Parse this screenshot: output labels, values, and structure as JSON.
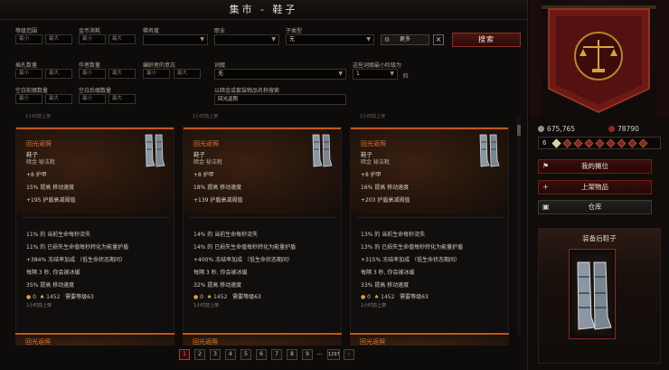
{
  "title": "集市 - 鞋子",
  "filters": {
    "row1": {
      "level_label": "等级范围",
      "level_min": "最小",
      "level_max": "最大",
      "price_label": "金币消耗",
      "price_min": "最小",
      "price_max": "最大",
      "rarity_label": "稀有度",
      "rarity_value": "",
      "class_label": "职业",
      "class_value": "",
      "subtype_label": "子类型",
      "subtype_value": "无",
      "more_label": "更多",
      "clear_label": "×",
      "search_label": "搜索"
    },
    "row2": {
      "sockets_label": "插孔数量",
      "sockets_min": "最小",
      "sockets_max": "最大",
      "dur_label": "作者数量",
      "dur_min": "最小",
      "dur_max": "最大",
      "will_label": "编织者的意志",
      "will_min": "最小",
      "will_max": "最大",
      "affix_label": "词缀",
      "affix_value": "无",
      "min_level_label": "这些词缀最小阶级为",
      "min_level_value": "1",
      "min_level_suffix": "阶"
    },
    "row3": {
      "empty_pre_label": "空白前缀数量",
      "empty_pre_min": "最小",
      "empty_pre_max": "最大",
      "empty_suf_label": "空白后缀数量",
      "empty_suf_min": "最小",
      "empty_suf_max": "最大",
      "name_search_label": "以暗金或套装物品名称搜索",
      "name_search_value": "回光返照"
    }
  },
  "cut_off_text": [
    "1小时前上架",
    "1小时前上架",
    "1小时前上架"
  ],
  "listings": [
    {
      "name": "回光返照",
      "type": "鞋子",
      "subtype": "暗金 秘法靴",
      "stats": [
        "+8 护甲",
        "15% 提高 移动速度",
        "+195 护盾衰减阈值"
      ],
      "affixes": [
        "11% 的 当前生命每秒流失",
        "11% 的 已损失生命值每秒转化为能量护盾",
        "+384% 冻结率加成 （低生命状态期间）",
        "每隔 3 秒, 你会被冰缓",
        "35% 提高 移动速度"
      ],
      "gold": "0",
      "tributes": "1452",
      "req_label": "需要等级",
      "req_level": "63",
      "time": "1小时前上架"
    },
    {
      "name": "回光返照",
      "type": "鞋子",
      "subtype": "暗金 秘法靴",
      "stats": [
        "+8 护甲",
        "18% 提高 移动速度",
        "+139 护盾衰减阈值"
      ],
      "affixes": [
        "14% 的 当前生命每秒流失",
        "14% 的 已损失生命值每秒转化为能量护盾",
        "+400% 冻结率加成 （低生命状态期间）",
        "每隔 3 秒, 你会被冰缓",
        "32% 提高 移动速度"
      ],
      "gold": "0",
      "tributes": "1452",
      "req_label": "需要等级",
      "req_level": "63",
      "time": "1小时前上架"
    },
    {
      "name": "回光返照",
      "type": "鞋子",
      "subtype": "暗金 秘法靴",
      "stats": [
        "+8 护甲",
        "16% 提高 移动速度",
        "+203 护盾衰减阈值"
      ],
      "affixes": [
        "13% 的 当前生命每秒流失",
        "13% 的 已损失生命值每秒转化为能量护盾",
        "+315% 冻结率加成 （低生命状态期间）",
        "每隔 3 秒, 你会被冰缓",
        "33% 提高 移动速度"
      ],
      "gold": "0",
      "tributes": "1452",
      "req_label": "需要等级",
      "req_level": "63",
      "time": "1小时前上架"
    }
  ],
  "next_row_names": [
    "回光返照",
    "回光返照",
    "回光返照"
  ],
  "pagination": {
    "pages": [
      "1",
      "2",
      "3",
      "4",
      "5",
      "6",
      "7",
      "8",
      "9"
    ],
    "ellipsis": "...",
    "last": "1297",
    "next": "›"
  },
  "sidebar": {
    "gold": "675,765",
    "tributes": "78790",
    "rank": "6",
    "my_stall": "我的摊位",
    "list_item": "上架物品",
    "stash": "仓库",
    "equipped_title": "装备后鞋子"
  },
  "colors": {
    "unique_name": "#e0782a",
    "accent_red": "#8a2f22",
    "active_page": "#ff6a4a"
  }
}
